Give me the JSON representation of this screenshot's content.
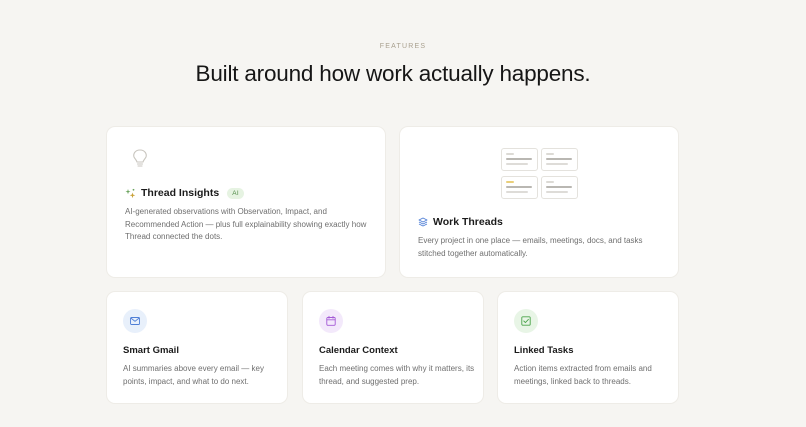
{
  "section": {
    "eyebrow": "FEATURES",
    "headline": "Built around how work actually happens."
  },
  "cards": {
    "thread_insights": {
      "title": "Thread Insights",
      "badge": "AI",
      "description": "AI-generated observations with Observation, Impact, and Recommended Action — plus full explainability showing exactly how Thread connected the dots.",
      "icon": "lightbulb-icon",
      "title_icon": "sparkles-icon"
    },
    "work_threads": {
      "title": "Work Threads",
      "description": "Every project in one place — emails, meetings, docs, and tasks stitched together automatically.",
      "icon": "layers-icon"
    },
    "smart_gmail": {
      "title": "Smart Gmail",
      "description": "AI summaries above every email — key points, impact, and what to do next.",
      "icon": "mail-icon"
    },
    "calendar_context": {
      "title": "Calendar Context",
      "description": "Each meeting comes with why it matters, its thread, and suggested prep.",
      "icon": "calendar-icon"
    },
    "linked_tasks": {
      "title": "Linked Tasks",
      "description": "Action items extracted from emails and meetings, linked back to threads.",
      "icon": "checkbox-icon"
    }
  },
  "colors": {
    "background": "#f6f5f2",
    "card": "#ffffff",
    "ai_badge_text": "#4f8a47",
    "ai_badge_bg": "#e6f3e2",
    "mail_accent": "#4f7fd6",
    "calendar_accent": "#a45bd6",
    "tasks_accent": "#4aa34a"
  }
}
